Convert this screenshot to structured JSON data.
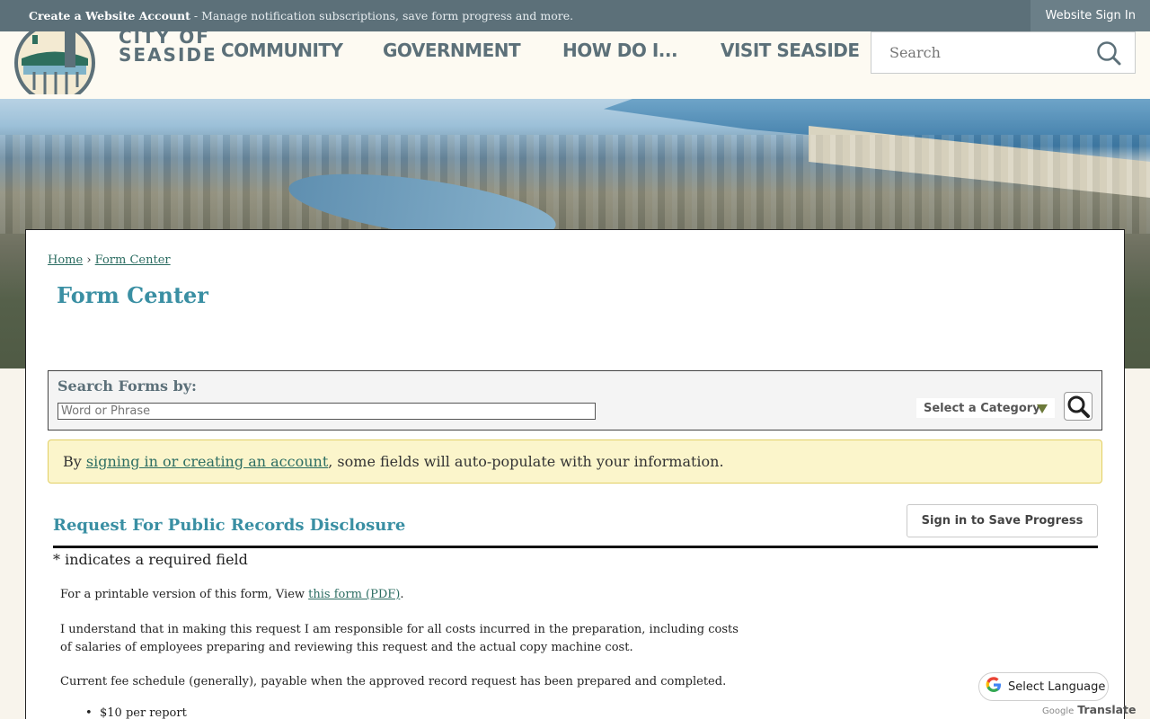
{
  "topbar": {
    "create_title": "Create a Website Account",
    "create_desc": " - Manage notification subscriptions, save form progress and more.",
    "signin_label": "Website Sign In"
  },
  "logo": {
    "line1": "CITY OF",
    "line2": "SEASIDE"
  },
  "nav": {
    "items": [
      {
        "label": "COMMUNITY"
      },
      {
        "label": "GOVERNMENT"
      },
      {
        "label": "HOW DO I..."
      },
      {
        "label": "VISIT SEASIDE"
      }
    ]
  },
  "search": {
    "placeholder": "Search",
    "icon": "search-icon"
  },
  "breadcrumb": {
    "home": "Home",
    "separator": "›",
    "current": "Form Center"
  },
  "page_title": "Form Center",
  "search_forms": {
    "label": "Search Forms by:",
    "placeholder": "Word or Phrase",
    "category_label": "Select a Category"
  },
  "notice": {
    "prefix": "By ",
    "link": "signing in or creating an account",
    "suffix": ", some fields will auto-populate with your information."
  },
  "form": {
    "title": "Request For Public Records Disclosure",
    "save_button": "Sign in to Save Progress",
    "required_note": "* indicates a required field",
    "printable_prefix": "For a printable version of this form, View ",
    "printable_link": "this form (PDF)",
    "printable_suffix": ".",
    "responsibility": "I understand that in making this request I am responsible for all costs incurred in the preparation, including costs of salaries of employees preparing and reviewing this request and the actual copy machine cost.",
    "fee_schedule": "Current fee schedule (generally), payable when the approved record request has been prepared and completed.",
    "fee_item": "$10 per report"
  },
  "translate": {
    "label": "Select Language",
    "powered_by": "Google",
    "product": "Translate"
  },
  "colors": {
    "topbar": "#5c7079",
    "title_teal": "#3a8fa3",
    "link_green": "#2c6d62",
    "notice_bg": "#fbf5cb"
  }
}
